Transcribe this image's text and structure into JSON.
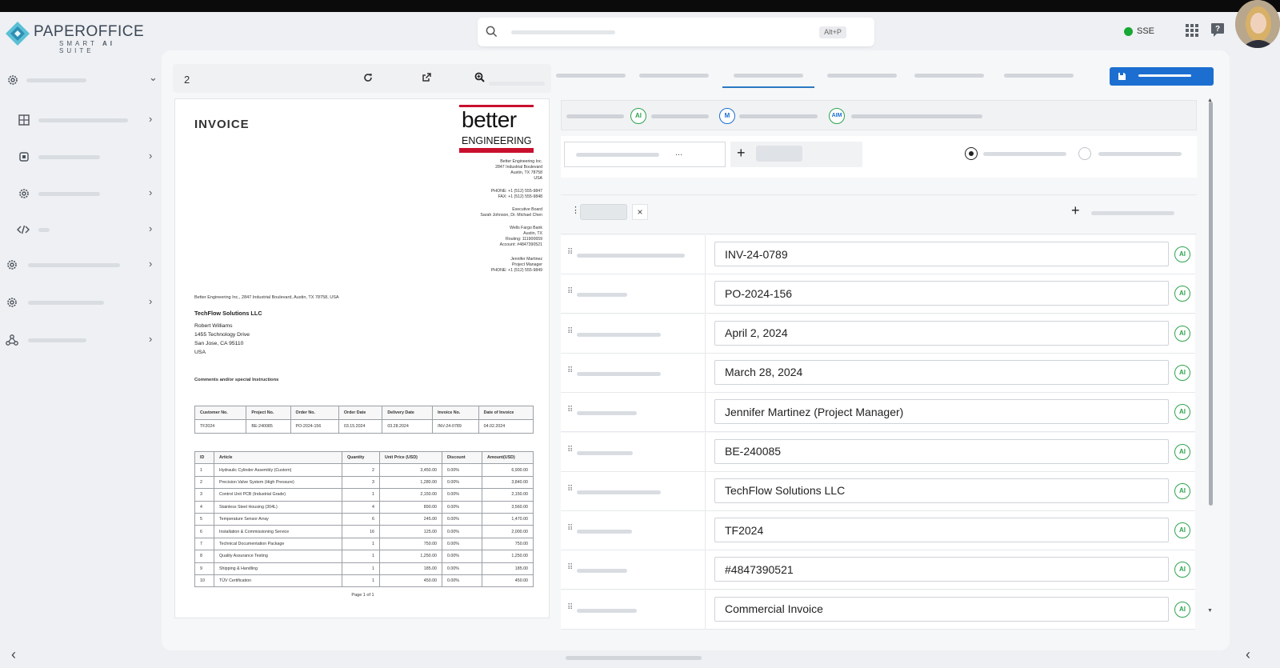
{
  "app": {
    "name": "PAPEROFFICE",
    "subtitle_pre": "SMART ",
    "subtitle_ai": "AI",
    "subtitle_post": " SUITE"
  },
  "search": {
    "shortcut": "Alt+P"
  },
  "status": {
    "label": "SSE",
    "color": "#18a834"
  },
  "colors": {
    "accent": "#1c6fd1",
    "ai_green": "#2ea44f",
    "m_blue": "#1c6fd1",
    "logo_red": "#c8102e"
  },
  "sidebar": {
    "items": [
      {
        "icon": "gear-icon"
      },
      {
        "icon": "grid-icon"
      },
      {
        "icon": "chip-icon"
      },
      {
        "icon": "gear-icon"
      },
      {
        "icon": "code-icon"
      },
      {
        "icon": "gear-icon"
      },
      {
        "icon": "gear-icon"
      },
      {
        "icon": "network-icon"
      }
    ]
  },
  "viewer": {
    "page_number": "2",
    "icons": [
      "refresh-icon",
      "external-link-icon",
      "zoom-icon"
    ]
  },
  "invoice": {
    "title": "INVOICE",
    "logo_top": "better",
    "logo_bottom": "ENGINEERING",
    "company_address": "Better Engineering Inc.\n2847 Industrial Boulevard\nAustin, TX 78758\nUSA",
    "phone_block": "PHONE: +1 (512) 555-9847\nFAX: +1 (512) 555-9848",
    "board_block": "Executive Board\nSarah Johnson, Dr. Michael Chen",
    "bank_block": "Wells Fargo Bank\nAustin, TX\nRouting: 111900659\nAccount: #4847390521",
    "contact_block": "Jennifer Martinez\nProject Manager\nPHONE: +1 (512) 555-9849",
    "sender_line": "Better Engineering Inc., 2847 Industrial Boulevard, Austin, TX 78758, USA",
    "recipient_company": "TechFlow Solutions LLC",
    "recipient_lines": [
      "Robert Williams",
      "1455 Technology Drive",
      "San Jose, CA 95110",
      "USA"
    ],
    "comments_label": "Comments and/or special Instructions",
    "meta_headers": [
      "Customer No.",
      "Project No.",
      "Order No.",
      "Order Date",
      "Delivery Date",
      "Invoice No.",
      "Date of Invoice"
    ],
    "meta_values": [
      "TF2024",
      "BE-240085",
      "PO-2024-156",
      "03.15.2024",
      "03.28.2024",
      "INV-24-0789",
      "04.02.2024"
    ],
    "item_headers": [
      "ID",
      "Article",
      "Quantity",
      "Unit Price (USD)",
      "Discount",
      "Amount(USD)"
    ],
    "items": [
      [
        "1",
        "Hydraulic Cylinder Assembly (Custom)",
        "2",
        "3,450.00",
        "0.00%",
        "6,900.00"
      ],
      [
        "2",
        "Precision Valve System (High Pressure)",
        "3",
        "1,280.00",
        "0.00%",
        "3,840.00"
      ],
      [
        "3",
        "Control Unit PCB (Industrial Grade)",
        "1",
        "2,150.00",
        "0.00%",
        "2,150.00"
      ],
      [
        "4",
        "Stainless Steel Housing (304L)",
        "4",
        "890.00",
        "0.00%",
        "3,560.00"
      ],
      [
        "5",
        "Temperature Sensor Array",
        "6",
        "245.00",
        "0.00%",
        "1,470.00"
      ],
      [
        "6",
        "Installation & Commissioning Service",
        "16",
        "125.00",
        "0.00%",
        "2,000.00"
      ],
      [
        "7",
        "Technical Documentation Package",
        "1",
        "750.00",
        "0.00%",
        "750.00"
      ],
      [
        "8",
        "Quality Assurance Testing",
        "1",
        "1,250.00",
        "0.00%",
        "1,250.00"
      ],
      [
        "9",
        "Shipping & Handling",
        "1",
        "185.00",
        "0.00%",
        "185.00"
      ],
      [
        "10",
        "TÜV Certification",
        "1",
        "450.00",
        "0.00%",
        "450.00"
      ]
    ],
    "footer": "Page 1 of 1"
  },
  "panel": {
    "badges": [
      "AI",
      "M",
      "AIM"
    ],
    "ellipsis": "...",
    "plus": "+",
    "close": "×",
    "ai_label": "AI",
    "fields": [
      {
        "value": "INV-24-0789"
      },
      {
        "value": "PO-2024-156"
      },
      {
        "value": "April 2, 2024"
      },
      {
        "value": "March 28, 2024"
      },
      {
        "value": "Jennifer Martinez (Project Manager)"
      },
      {
        "value": "BE-240085"
      },
      {
        "value": "TechFlow Solutions LLC"
      },
      {
        "value": "TF2024"
      },
      {
        "value": "#4847390521"
      },
      {
        "value": "Commercial Invoice"
      }
    ]
  }
}
